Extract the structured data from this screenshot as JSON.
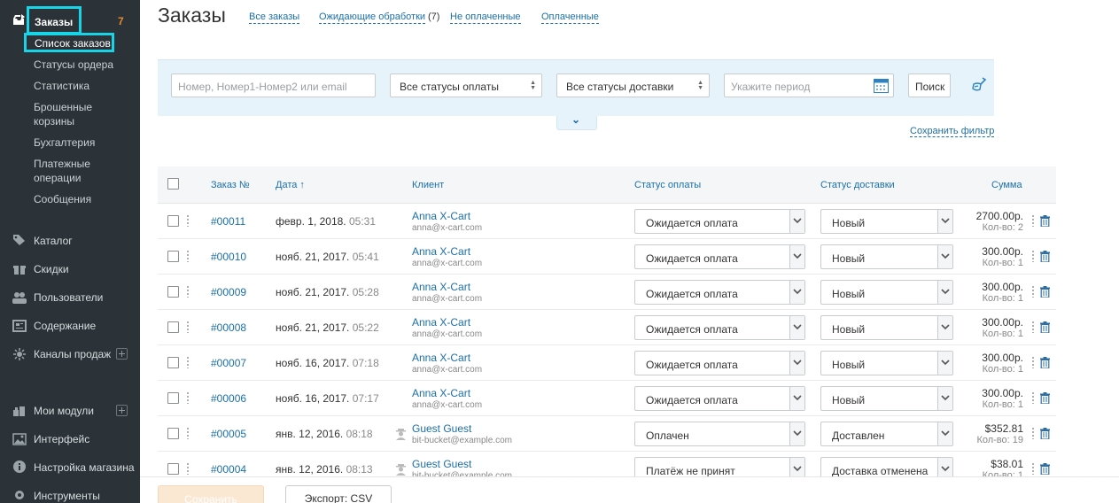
{
  "sidebar": {
    "orders_label": "Заказы",
    "orders_count": "7",
    "active_sub": "Список заказов",
    "sub_items": [
      {
        "label": "Статусы ордера"
      },
      {
        "label": "Статистика"
      },
      {
        "label": "Брошенные корзины"
      },
      {
        "label": "Бухгалтерия"
      },
      {
        "label": "Платежные операции"
      },
      {
        "label": "Сообщения"
      }
    ],
    "main_items": [
      {
        "label": "Каталог",
        "icon": "tag-icon"
      },
      {
        "label": "Скидки",
        "icon": "gift-icon"
      },
      {
        "label": "Пользователи",
        "icon": "users-icon"
      },
      {
        "label": "Содержание",
        "icon": "content-icon"
      },
      {
        "label": "Каналы продаж",
        "icon": "sales-channels-icon"
      },
      {
        "label": "Мои модули",
        "icon": "modules-icon"
      },
      {
        "label": "Интерфейс",
        "icon": "image-icon"
      },
      {
        "label": "Настройка магазина",
        "icon": "info-icon"
      },
      {
        "label": "Инструменты",
        "icon": "gear-icon"
      }
    ]
  },
  "header": {
    "title": "Заказы",
    "tabs": [
      {
        "label": "Все заказы"
      },
      {
        "label": "Ожидающие обработки",
        "count": "(7)"
      },
      {
        "label": "Не оплаченные"
      },
      {
        "label": "Оплаченные"
      }
    ]
  },
  "filter": {
    "search_placeholder": "Номер, Номер1-Номер2 или email",
    "payment_status": "Все статусы оплаты",
    "shipping_status": "Все статусы доставки",
    "period_placeholder": "Укажите период",
    "search_button": "Поиск",
    "save_filter": "Сохранить фильтр",
    "toggle_glyph": "⌄"
  },
  "table": {
    "headers": {
      "order": "Заказ №",
      "date": "Дата ↑",
      "customer": "Клиент",
      "payment": "Статус оплаты",
      "shipping": "Статус доставки",
      "sum": "Сумма"
    },
    "rows": [
      {
        "id": "#00011",
        "date": "февр. 1, 2018.",
        "time": "05:31",
        "name": "Anna X-Cart",
        "email": "anna@x-cart.com",
        "guest": false,
        "payment": "Ожидается оплата",
        "shipping": "Новый",
        "sum": "2700.00р.",
        "qty": "Кол-во: 2"
      },
      {
        "id": "#00010",
        "date": "нояб. 21, 2017.",
        "time": "05:41",
        "name": "Anna X-Cart",
        "email": "anna@x-cart.com",
        "guest": false,
        "payment": "Ожидается оплата",
        "shipping": "Новый",
        "sum": "300.00р.",
        "qty": "Кол-во: 1"
      },
      {
        "id": "#00009",
        "date": "нояб. 21, 2017.",
        "time": "05:28",
        "name": "Anna X-Cart",
        "email": "anna@x-cart.com",
        "guest": false,
        "payment": "Ожидается оплата",
        "shipping": "Новый",
        "sum": "300.00р.",
        "qty": "Кол-во: 1"
      },
      {
        "id": "#00008",
        "date": "нояб. 21, 2017.",
        "time": "05:22",
        "name": "Anna X-Cart",
        "email": "anna@x-cart.com",
        "guest": false,
        "payment": "Ожидается оплата",
        "shipping": "Новый",
        "sum": "300.00р.",
        "qty": "Кол-во: 1"
      },
      {
        "id": "#00007",
        "date": "нояб. 16, 2017.",
        "time": "07:18",
        "name": "Anna X-Cart",
        "email": "anna@x-cart.com",
        "guest": false,
        "payment": "Ожидается оплата",
        "shipping": "Новый",
        "sum": "300.00р.",
        "qty": "Кол-во: 1"
      },
      {
        "id": "#00006",
        "date": "нояб. 16, 2017.",
        "time": "07:17",
        "name": "Anna X-Cart",
        "email": "anna@x-cart.com",
        "guest": false,
        "payment": "Ожидается оплата",
        "shipping": "Новый",
        "sum": "300.00р.",
        "qty": "Кол-во: 1"
      },
      {
        "id": "#00005",
        "date": "янв. 12, 2016.",
        "time": "08:18",
        "name": "Guest Guest",
        "email": "bit-bucket@example.com",
        "guest": true,
        "payment": "Оплачен",
        "shipping": "Доставлен",
        "sum": "$352.81",
        "qty": "Кол-во: 19"
      },
      {
        "id": "#00004",
        "date": "янв. 12, 2016.",
        "time": "08:13",
        "name": "Guest Guest",
        "email": "bit-bucket@example.com",
        "guest": true,
        "payment": "Платёж не принят",
        "shipping": "Доставка отменена",
        "sum": "$38.01",
        "qty": "Кол-во: 1"
      }
    ]
  },
  "footer": {
    "save": "Сохранить",
    "export": "Экспорт: CSV"
  },
  "colors": {
    "sidebar_bg": "#2b3338",
    "highlight": "#19d3e6",
    "link": "#1b6fa8",
    "count": "#e8892c",
    "filter_bg": "#e6f3fb"
  }
}
